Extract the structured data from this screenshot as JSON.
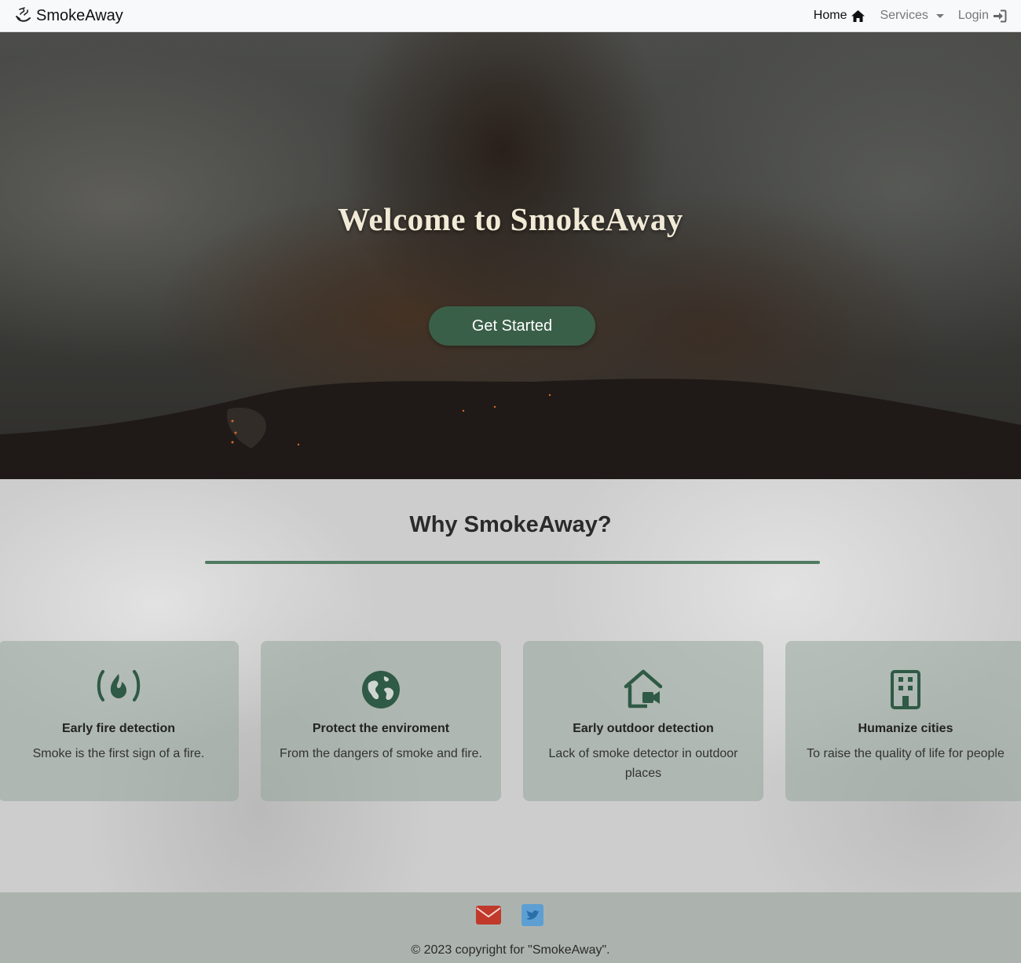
{
  "nav": {
    "brand": "SmokeAway",
    "home_label": "Home",
    "services_label": "Services",
    "login_label": "Login"
  },
  "hero": {
    "title": "Welcome to SmokeAway",
    "button_label": "Get Started"
  },
  "why": {
    "title": "Why SmokeAway?",
    "cards": [
      {
        "icon": "fire-icon",
        "title": "Early fire detection",
        "text": "Smoke is the first sign of a fire."
      },
      {
        "icon": "globe-icon",
        "title": "Protect the enviroment",
        "text": "From the dangers of smoke and fire."
      },
      {
        "icon": "house-camera-icon",
        "title": "Early outdoor detection",
        "text": "Lack of smoke detector in outdoor places"
      },
      {
        "icon": "building-icon",
        "title": "Humanize cities",
        "text": "To raise the quality of life for people"
      }
    ]
  },
  "footer": {
    "copyright": "© 2023 copyright for \"SmokeAway\"."
  },
  "colors": {
    "accent": "#3a5f48",
    "icon": "#2f5a45",
    "mail": "#c0392b",
    "twitter": "#5d9fd3"
  }
}
